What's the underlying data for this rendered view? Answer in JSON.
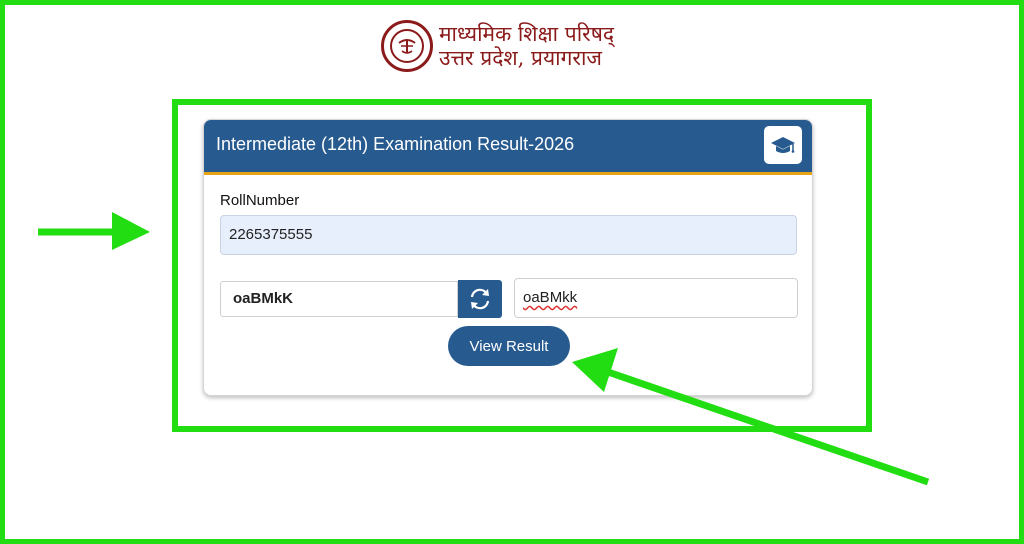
{
  "header": {
    "org_line1": "माध्यमिक शिक्षा परिषद्",
    "org_line2": "उत्तर प्रदेश, प्रयागराज"
  },
  "card": {
    "title": "Intermediate (12th) Examination Result-2026",
    "roll_label": "RollNumber",
    "roll_value": "2265375555",
    "captcha_text": "oaBMkK",
    "captcha_input_value": "oaBMkk",
    "submit_label": "View Result"
  },
  "colors": {
    "primary": "#275a8f",
    "accent": "#e8a317",
    "annotation": "#22dd11",
    "org": "#8b1a1a"
  },
  "icons": {
    "logo": "up-seal-icon",
    "cap": "graduation-cap-icon",
    "refresh": "refresh-icon"
  }
}
